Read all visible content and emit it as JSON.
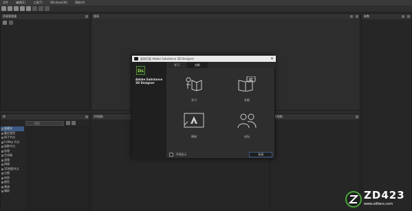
{
  "menubar": {
    "items": [
      "文件",
      "编辑(E)",
      "工具(T)",
      "Windows(W)",
      "帮助(H)"
    ]
  },
  "panels": {
    "explorer": {
      "title": "资源管理器"
    },
    "graph": {
      "title": "图表"
    },
    "params": {
      "title": "参数"
    },
    "library": {
      "title": "库"
    },
    "view3d": {
      "title": "3D视图"
    },
    "view2d": {
      "title": "2D视图"
    }
  },
  "library": {
    "search_placeholder": "搜索",
    "items": [
      "收藏夹",
      "最近使用",
      "原子节点",
      "FxMap 节点",
      "函数节点",
      "纹理",
      "生成器",
      "滤镜",
      "网格",
      "3D视图节点",
      "位图",
      "材质",
      "颜色",
      "噪波",
      "辅助"
    ]
  },
  "dialog": {
    "title": "起始页面 Adobe Substance 3D Designer",
    "close": "✕",
    "logo_text": "Ds",
    "product_name": "Adobe Substance 3D Designer",
    "tabs": [
      "学习",
      "分析"
    ],
    "active_tab": 1,
    "tiles": [
      {
        "label": "学习",
        "icon": "learn-icon"
      },
      {
        "label": "文档",
        "icon": "docs-icon"
      },
      {
        "label": "网站",
        "icon": "website-icon"
      },
      {
        "label": "论坛",
        "icon": "forum-icon"
      }
    ],
    "dont_show": "不再显示",
    "close_button": "关闭"
  },
  "watermark": {
    "text": "ZD423",
    "url": "www.zdfans.com"
  },
  "colors": {
    "accent": "#3d5a86",
    "logo_green": "#9ad35b",
    "logo_bg": "#1d2a1a"
  }
}
